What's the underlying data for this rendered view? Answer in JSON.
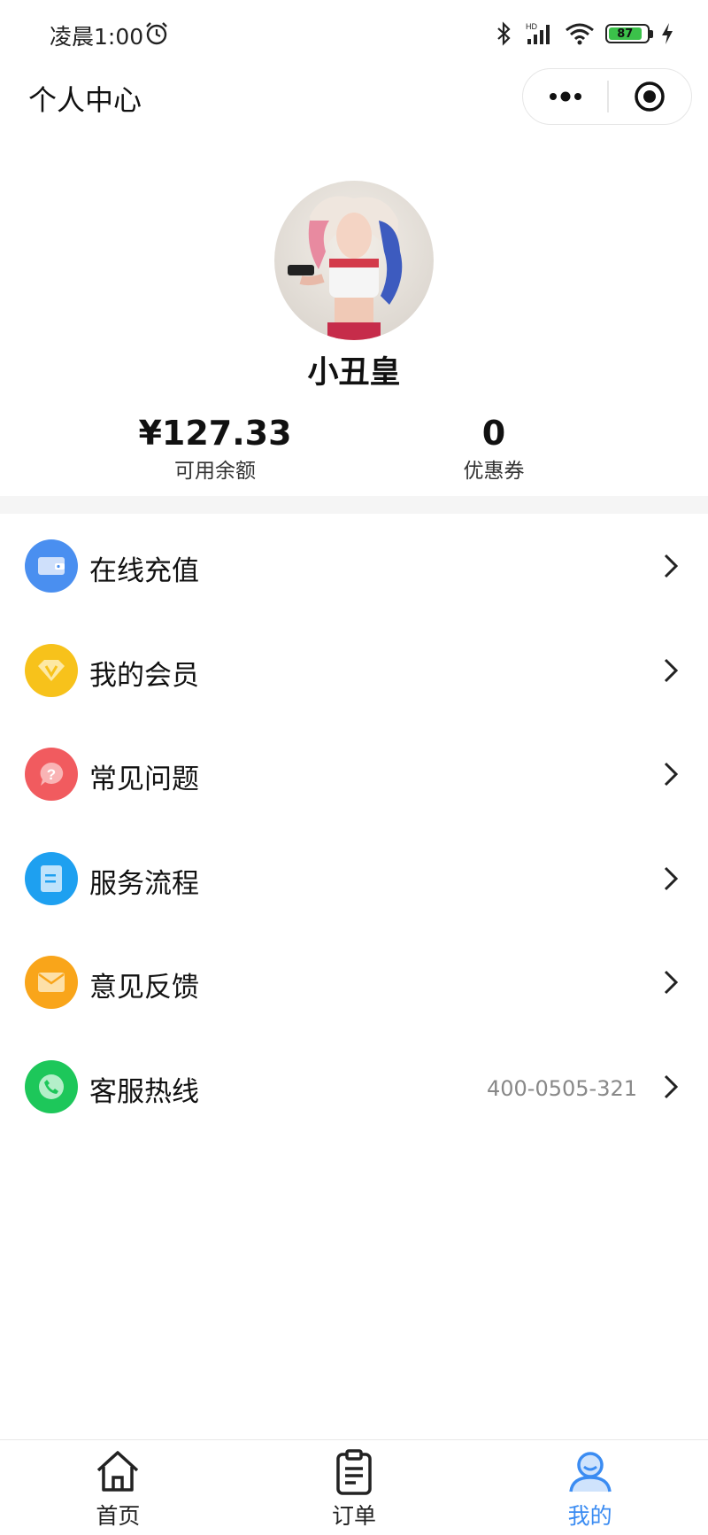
{
  "status_bar": {
    "time": "凌晨1:00",
    "battery": "87",
    "icons": [
      "alarm-icon",
      "bluetooth-icon",
      "signal-icon",
      "wifi-icon",
      "battery-icon",
      "charging-icon"
    ]
  },
  "nav": {
    "title": "个人中心",
    "capsule_icons": [
      "more-icon",
      "close-mini-program-icon"
    ]
  },
  "profile": {
    "username": "小丑皇",
    "balance_value": "¥127.33",
    "balance_label": "可用余额",
    "coupon_value": "0",
    "coupon_label": "优惠券"
  },
  "menu": [
    {
      "label": "在线充值",
      "icon": "wallet-icon",
      "color": "#4a8ff0",
      "extra": ""
    },
    {
      "label": "我的会员",
      "icon": "vip-diamond-icon",
      "color": "#f7c21b",
      "extra": ""
    },
    {
      "label": "常见问题",
      "icon": "question-icon",
      "color": "#f15b5f",
      "extra": ""
    },
    {
      "label": "服务流程",
      "icon": "document-icon",
      "color": "#1ea0f0",
      "extra": ""
    },
    {
      "label": "意见反馈",
      "icon": "envelope-icon",
      "color": "#f9a51a",
      "extra": ""
    },
    {
      "label": "客服热线",
      "icon": "phone-icon",
      "color": "#1dc75a",
      "extra": "400-0505-321"
    }
  ],
  "tabs": [
    {
      "label": "首页",
      "icon": "home-icon",
      "active": false
    },
    {
      "label": "订单",
      "icon": "order-clipboard-icon",
      "active": false
    },
    {
      "label": "我的",
      "icon": "user-icon",
      "active": true
    }
  ],
  "colors": {
    "accent": "#3b8cf2",
    "divider": "#f5f5f5"
  }
}
